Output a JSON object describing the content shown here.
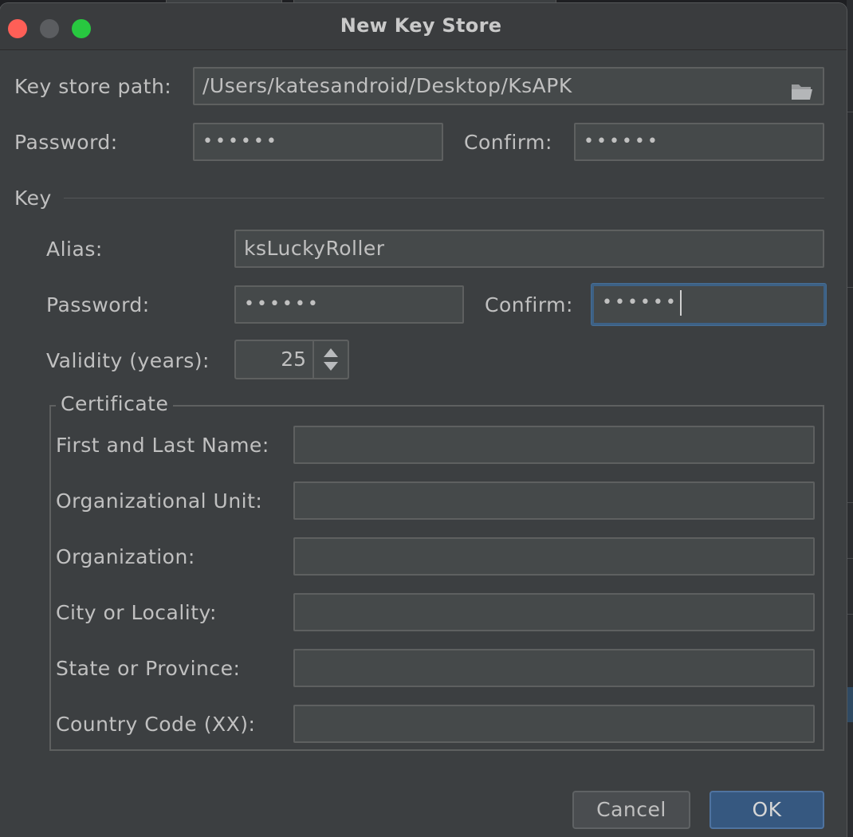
{
  "window": {
    "title": "New Key Store"
  },
  "keystore": {
    "path_label": "Key store path:",
    "path_value": "/Users/katesandroid/Desktop/KsAPK",
    "password_label": "Password:",
    "password_value": "••••••",
    "confirm_label": "Confirm:",
    "confirm_value": "••••••"
  },
  "key": {
    "section_label": "Key",
    "alias_label": "Alias:",
    "alias_value": "ksLuckyRoller",
    "password_label": "Password:",
    "password_value": "••••••",
    "confirm_label": "Confirm:",
    "confirm_value": "••••••",
    "validity_label": "Validity (years):",
    "validity_value": "25"
  },
  "certificate": {
    "title": "Certificate",
    "fields": [
      {
        "label": "First and Last Name:",
        "value": ""
      },
      {
        "label": "Organizational Unit:",
        "value": ""
      },
      {
        "label": "Organization:",
        "value": ""
      },
      {
        "label": "City or Locality:",
        "value": ""
      },
      {
        "label": "State or Province:",
        "value": ""
      },
      {
        "label": "Country Code (XX):",
        "value": ""
      }
    ]
  },
  "buttons": {
    "cancel": "Cancel",
    "ok": "OK"
  },
  "colors": {
    "accent": "#365880",
    "focus_border": "#3d6185",
    "background": "#3c3f41"
  }
}
